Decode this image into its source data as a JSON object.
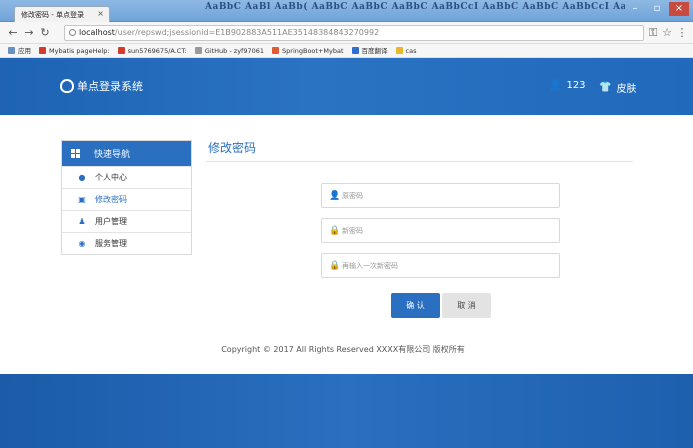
{
  "browser": {
    "tab_title": "修改密码 - 单点登录",
    "title_banner": "AaBbC AaBl AaBb( AaBbC AaBbC AaBbC AaBbCcI AaBbC AaBbC AaBbCcI AaBbC AaBbCcI AaBbCcI",
    "url_host": "localhost",
    "url_path": "/user/repswd;jsessionid=E1B902883A511AE35148384843270992",
    "bookmarks": [
      {
        "label": "应用",
        "color": "#6b8ec4"
      },
      {
        "label": "Mybatis pageHelp:",
        "color": "#d23c2c"
      },
      {
        "label": "sun5769675/A.CT:",
        "color": "#d23c2c"
      },
      {
        "label": "GitHub - zyf97061",
        "color": "#999999"
      },
      {
        "label": "SpringBoot+Mybat",
        "color": "#e05a32"
      },
      {
        "label": "百度翻译",
        "color": "#2f6fd0"
      },
      {
        "label": "cas",
        "color": "#e8b82f"
      }
    ]
  },
  "header": {
    "app_title": "单点登录系统",
    "username": "123",
    "skin_label": "皮肤"
  },
  "sidebar": {
    "heading": "快速导航",
    "items": [
      {
        "label": "个人中心",
        "icon": "user-icon",
        "active": false
      },
      {
        "label": "修改密码",
        "icon": "lock-icon",
        "active": true
      },
      {
        "label": "用户管理",
        "icon": "users-icon",
        "active": false
      },
      {
        "label": "服务管理",
        "icon": "eye-icon",
        "active": false
      }
    ]
  },
  "main": {
    "title": "修改密码",
    "fields": [
      {
        "placeholder": "原密码",
        "icon": "user-icon"
      },
      {
        "placeholder": "新密码",
        "icon": "lock-icon"
      },
      {
        "placeholder": "再输入一次新密码",
        "icon": "lock-icon"
      }
    ],
    "confirm_label": "确 认",
    "cancel_label": "取 消"
  },
  "footer": {
    "copyright": "Copyright © 2017 All Rights Reserved XXXX有限公司 版权所有"
  },
  "colors": {
    "accent": "#2a6fc0",
    "header_bg": "#1e63b4",
    "cancel_bg": "#e3e3e3"
  }
}
